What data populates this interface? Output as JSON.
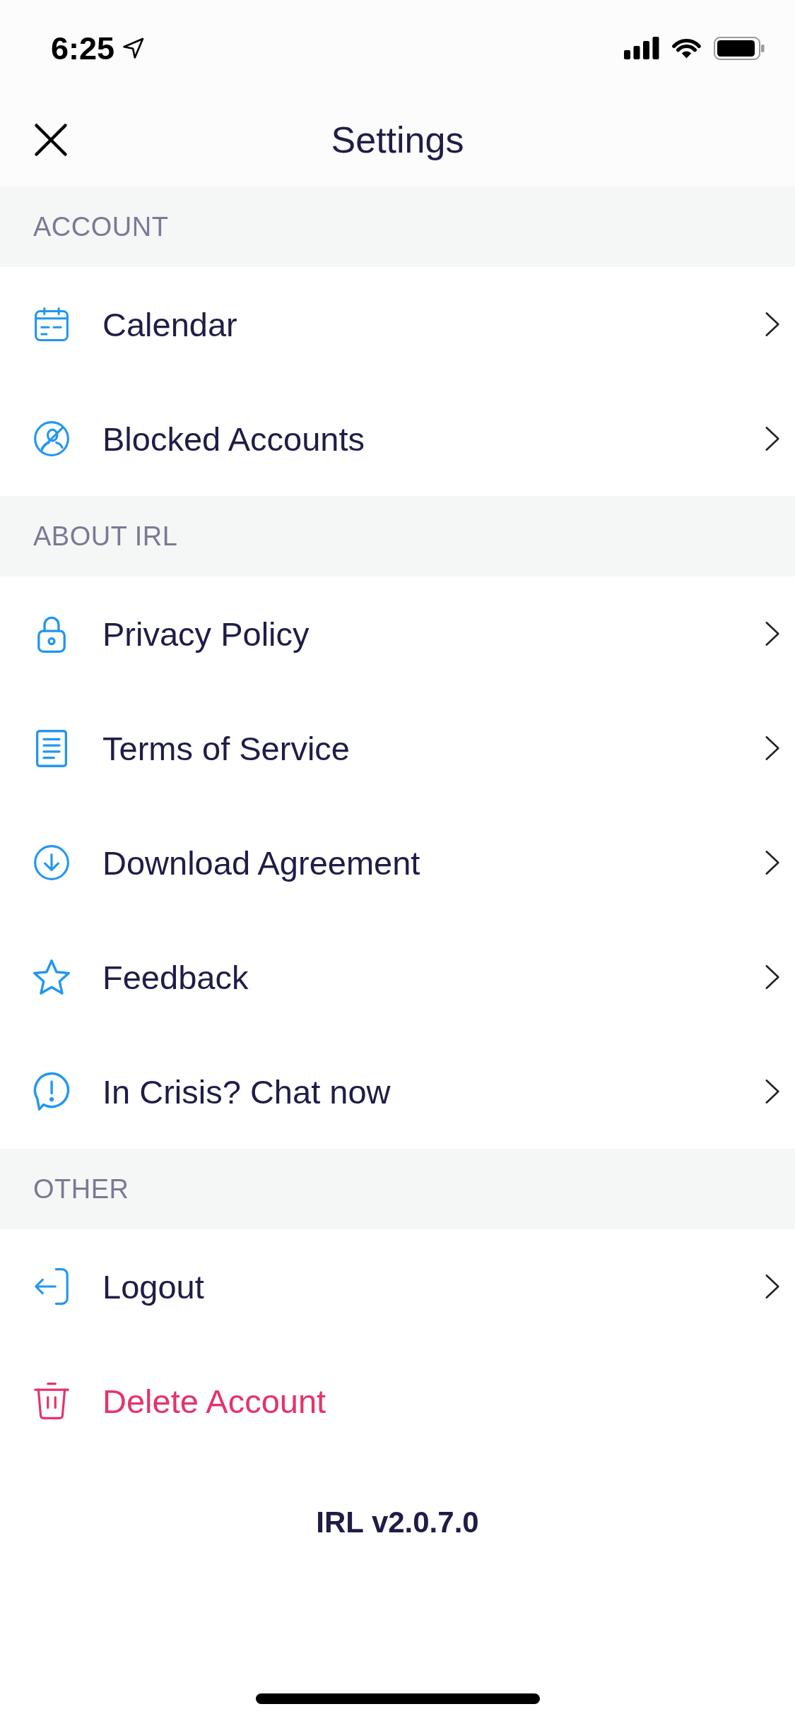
{
  "status_bar": {
    "time": "6:25"
  },
  "nav_bar": {
    "title": "Settings"
  },
  "sections": [
    {
      "header": "ACCOUNT",
      "items": [
        {
          "label": "Calendar",
          "kind": "link"
        },
        {
          "label": "Blocked Accounts",
          "kind": "link"
        }
      ]
    },
    {
      "header": "ABOUT IRL",
      "items": [
        {
          "label": "Privacy Policy",
          "kind": "link"
        },
        {
          "label": "Terms of Service",
          "kind": "link"
        },
        {
          "label": "Download Agreement",
          "kind": "link"
        },
        {
          "label": "Feedback",
          "kind": "link"
        },
        {
          "label": "In Crisis? Chat now",
          "kind": "link"
        }
      ]
    },
    {
      "header": "OTHER",
      "items": [
        {
          "label": "Logout",
          "kind": "link"
        },
        {
          "label": "Delete Account",
          "kind": "danger"
        }
      ]
    }
  ],
  "footer": {
    "version": "IRL v2.0.7.0"
  }
}
